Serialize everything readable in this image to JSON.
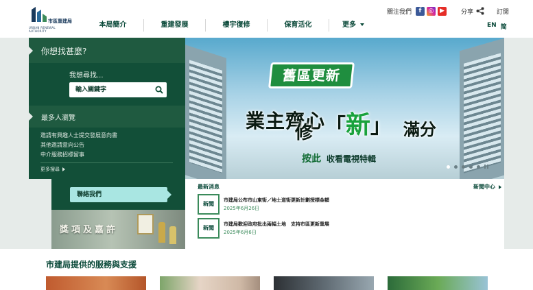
{
  "logo": {
    "name_zh": "市區重建局",
    "name_en_lines": [
      "URBAN RENEWAL",
      "AUTHORITY"
    ],
    "brand_color": "#1a3a5c"
  },
  "nav": {
    "items": [
      {
        "label": "本局簡介"
      },
      {
        "label": "重建發展"
      },
      {
        "label": "樓宇復修"
      },
      {
        "label": "保育活化"
      },
      {
        "label": "更多"
      }
    ]
  },
  "top_util": {
    "follow_label": "關注我們",
    "social": [
      {
        "icon": "facebook-icon",
        "glyph": "f",
        "color": "#3b5998"
      },
      {
        "icon": "instagram-icon",
        "glyph": "◎",
        "color": "#d6249f"
      },
      {
        "icon": "youtube-icon",
        "glyph": "▶",
        "color": "#e52d27"
      }
    ],
    "share_label": "分享",
    "subscribe_label": "訂閱"
  },
  "lang": {
    "en": "EN",
    "sc": "简"
  },
  "search": {
    "title": "你想找甚麼?",
    "prompt": "我想尋找...",
    "placeholder": "輸入關鍵字"
  },
  "popular": {
    "title": "最多人瀏覽",
    "items": [
      "邀請有興趣人士提交發展意向書",
      "其他邀請意向公告",
      "中介服務招標留事"
    ],
    "more_label": "更多搜尋"
  },
  "contact": {
    "label": "聯絡我們"
  },
  "awards": {
    "label": "獎項及嘉許"
  },
  "banner": {
    "tag": "舊區更新",
    "headline_1": "業主齊心",
    "headline_2": "修",
    "headline_3": "新",
    "headline_4": "滿分",
    "cta_press": "按此",
    "cta_text": "收看電視特輯",
    "slides_total": 5,
    "slide_active": 1,
    "accent": "#1f8e3f"
  },
  "news": {
    "title": "最新消息",
    "center_label": "新聞中心",
    "items": [
      {
        "badge": "新聞",
        "headline": "市建局公布市山東街／地士道街更新計劃授標金額",
        "date": "2025年6月26日"
      },
      {
        "badge": "新聞",
        "headline": "市建局歡迎政府批出兩幅土地　支持市區更新重展",
        "date": "2025年6月6日"
      }
    ]
  },
  "services": {
    "title": "市建局提供的服務與支援"
  },
  "colors": {
    "primary_green": "#124f38",
    "panel_green": "#1f5a40",
    "accent_teal": "#a9e6e2",
    "text_green": "#0b4a3a"
  }
}
